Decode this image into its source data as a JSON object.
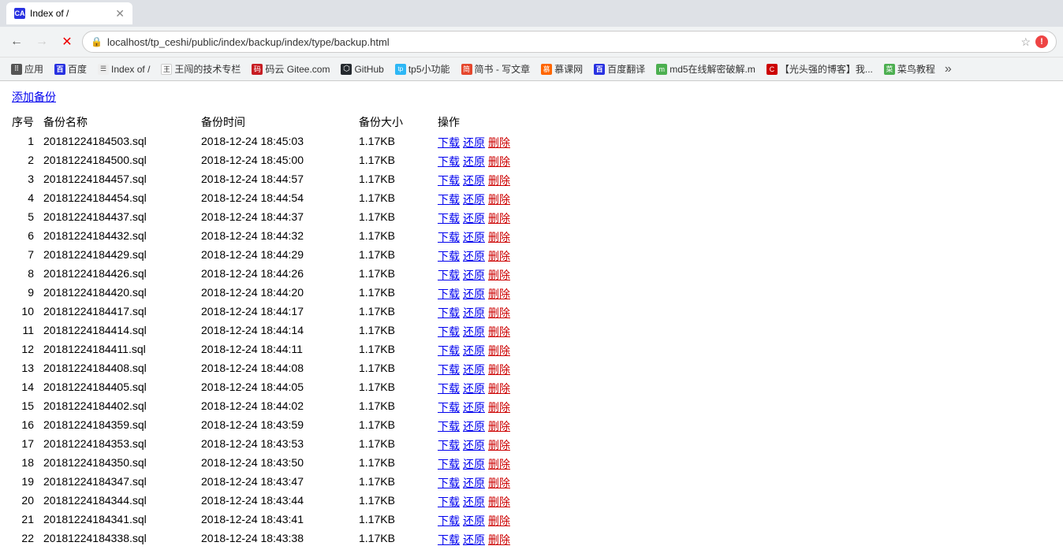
{
  "browser": {
    "tab": {
      "favicon_text": "CA",
      "title": "Index of /"
    },
    "nav": {
      "back_disabled": false,
      "forward_disabled": true,
      "url": "localhost/tp_ceshi/public/index/backup/index/type/backup.html"
    },
    "bookmarks": [
      {
        "id": "apps",
        "icon_type": "apps",
        "icon_text": "⠿",
        "label": "应用"
      },
      {
        "id": "baidu",
        "icon_type": "baidu",
        "icon_text": "百",
        "label": "百度"
      },
      {
        "id": "index",
        "icon_type": "page",
        "icon_text": "☰",
        "label": "Index of /"
      },
      {
        "id": "wj",
        "icon_type": "wj",
        "icon_text": "王",
        "label": "王闯的技术专栏"
      },
      {
        "id": "gitee",
        "icon_type": "gitee",
        "icon_text": "码",
        "label": "码云 Gitee.com"
      },
      {
        "id": "github",
        "icon_type": "github",
        "icon_text": "♦",
        "label": "GitHub"
      },
      {
        "id": "tp5",
        "icon_type": "tp5",
        "icon_text": "tp",
        "label": "tp5小功能"
      },
      {
        "id": "jj",
        "icon_type": "jj",
        "icon_text": "简",
        "label": "简书 - 写文章"
      },
      {
        "id": "mk",
        "icon_type": "mk",
        "icon_text": "慕",
        "label": "慕课网"
      },
      {
        "id": "bd",
        "icon_type": "bd",
        "icon_text": "百",
        "label": "百度翻译"
      },
      {
        "id": "md5",
        "icon_type": "md5",
        "icon_text": "m",
        "label": "md5在线解密破解.m"
      },
      {
        "id": "gtq",
        "icon_type": "gtq",
        "icon_text": "C",
        "label": "【光头强的博客】我..."
      },
      {
        "id": "cn",
        "icon_type": "cn",
        "icon_text": "菜",
        "label": "菜鸟教程"
      },
      {
        "id": "more",
        "icon_type": "more",
        "icon_text": "»",
        "label": ""
      }
    ]
  },
  "page": {
    "add_backup_label": "添加备份",
    "headers": {
      "num": "序号",
      "name": "备份名称",
      "time": "备份时间",
      "size": "备份大小",
      "actions": "操作"
    },
    "actions": {
      "download": "下载",
      "restore": "还原",
      "delete": "删除"
    },
    "rows": [
      {
        "num": 1,
        "name": "20181224184503.sql",
        "time": "2018-12-24 18:45:03",
        "size": "1.17KB"
      },
      {
        "num": 2,
        "name": "20181224184500.sql",
        "time": "2018-12-24 18:45:00",
        "size": "1.17KB"
      },
      {
        "num": 3,
        "name": "20181224184457.sql",
        "time": "2018-12-24 18:44:57",
        "size": "1.17KB"
      },
      {
        "num": 4,
        "name": "20181224184454.sql",
        "time": "2018-12-24 18:44:54",
        "size": "1.17KB"
      },
      {
        "num": 5,
        "name": "20181224184437.sql",
        "time": "2018-12-24 18:44:37",
        "size": "1.17KB"
      },
      {
        "num": 6,
        "name": "20181224184432.sql",
        "time": "2018-12-24 18:44:32",
        "size": "1.17KB"
      },
      {
        "num": 7,
        "name": "20181224184429.sql",
        "time": "2018-12-24 18:44:29",
        "size": "1.17KB"
      },
      {
        "num": 8,
        "name": "20181224184426.sql",
        "time": "2018-12-24 18:44:26",
        "size": "1.17KB"
      },
      {
        "num": 9,
        "name": "20181224184420.sql",
        "time": "2018-12-24 18:44:20",
        "size": "1.17KB"
      },
      {
        "num": 10,
        "name": "20181224184417.sql",
        "time": "2018-12-24 18:44:17",
        "size": "1.17KB"
      },
      {
        "num": 11,
        "name": "20181224184414.sql",
        "time": "2018-12-24 18:44:14",
        "size": "1.17KB"
      },
      {
        "num": 12,
        "name": "20181224184411.sql",
        "time": "2018-12-24 18:44:11",
        "size": "1.17KB"
      },
      {
        "num": 13,
        "name": "20181224184408.sql",
        "time": "2018-12-24 18:44:08",
        "size": "1.17KB"
      },
      {
        "num": 14,
        "name": "20181224184405.sql",
        "time": "2018-12-24 18:44:05",
        "size": "1.17KB"
      },
      {
        "num": 15,
        "name": "20181224184402.sql",
        "time": "2018-12-24 18:44:02",
        "size": "1.17KB"
      },
      {
        "num": 16,
        "name": "20181224184359.sql",
        "time": "2018-12-24 18:43:59",
        "size": "1.17KB"
      },
      {
        "num": 17,
        "name": "20181224184353.sql",
        "time": "2018-12-24 18:43:53",
        "size": "1.17KB"
      },
      {
        "num": 18,
        "name": "20181224184350.sql",
        "time": "2018-12-24 18:43:50",
        "size": "1.17KB"
      },
      {
        "num": 19,
        "name": "20181224184347.sql",
        "time": "2018-12-24 18:43:47",
        "size": "1.17KB"
      },
      {
        "num": 20,
        "name": "20181224184344.sql",
        "time": "2018-12-24 18:43:44",
        "size": "1.17KB"
      },
      {
        "num": 21,
        "name": "20181224184341.sql",
        "time": "2018-12-24 18:43:41",
        "size": "1.17KB"
      },
      {
        "num": 22,
        "name": "20181224184338.sql",
        "time": "2018-12-24 18:43:38",
        "size": "1.17KB"
      }
    ]
  }
}
